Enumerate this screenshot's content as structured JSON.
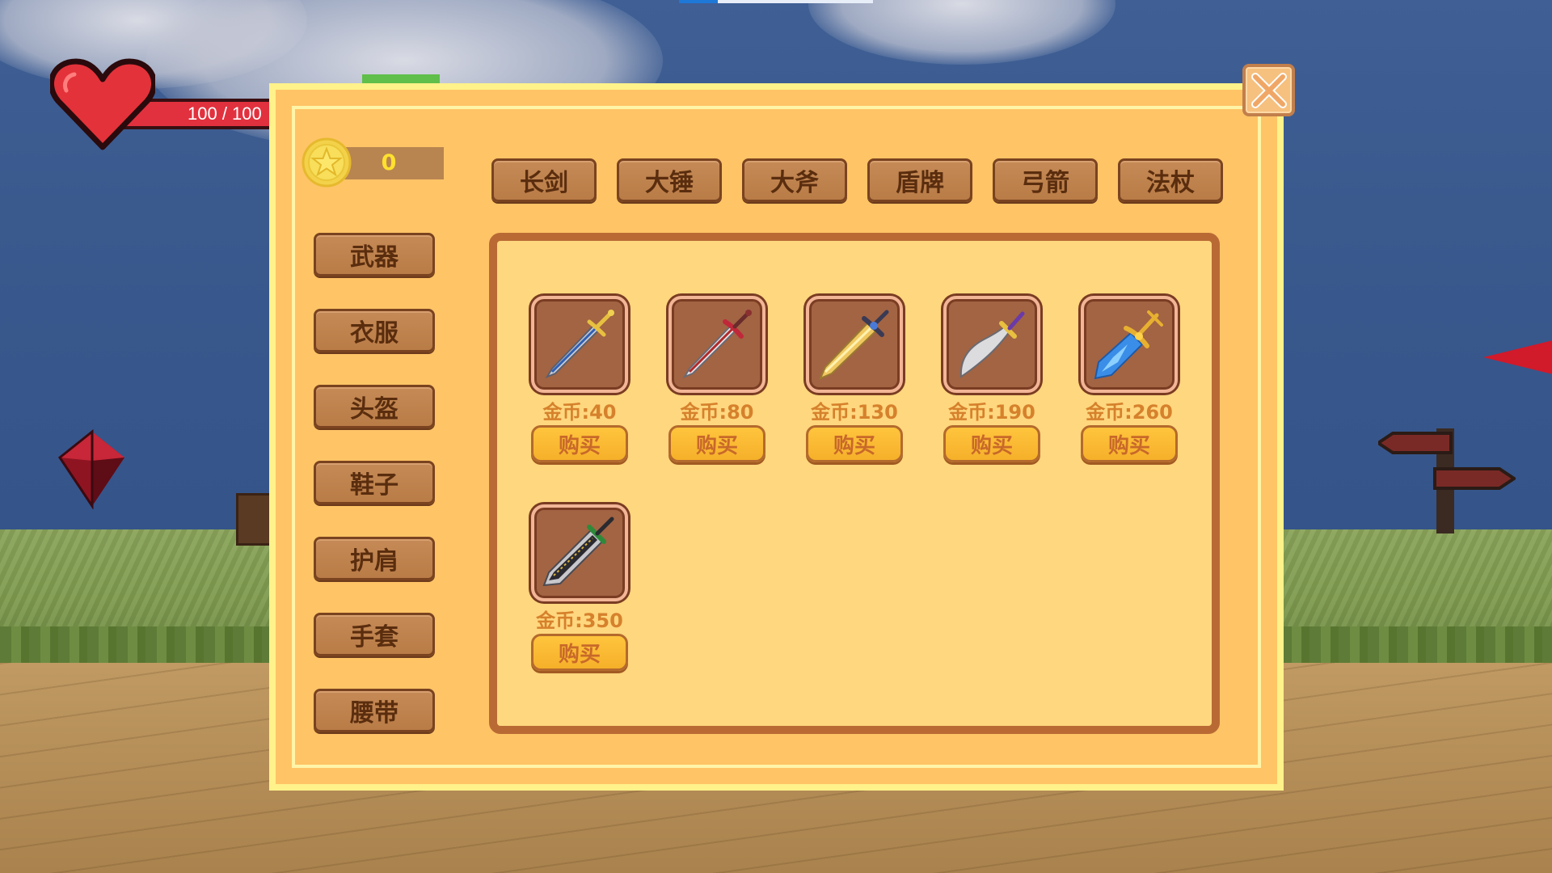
{
  "hud": {
    "hp_text": "100  / 100",
    "hp_current": 100,
    "hp_max": 100
  },
  "shop": {
    "coins": "0",
    "tabs": [
      "长剑",
      "大锤",
      "大斧",
      "盾牌",
      "弓箭",
      "法杖"
    ],
    "categories": [
      "武器",
      "衣服",
      "头盔",
      "鞋子",
      "护肩",
      "手套",
      "腰带"
    ],
    "items": [
      {
        "icon": "longsword-blue-icon",
        "price": "金币:40",
        "buy": "购买"
      },
      {
        "icon": "longsword-red-icon",
        "price": "金币:80",
        "buy": "购买"
      },
      {
        "icon": "longsword-gold-icon",
        "price": "金币:130",
        "buy": "购买"
      },
      {
        "icon": "scimitar-icon",
        "price": "金币:190",
        "buy": "购买"
      },
      {
        "icon": "crystal-sword-icon",
        "price": "金币:260",
        "buy": "购买"
      },
      {
        "icon": "runed-greatsword-icon",
        "price": "金币:350",
        "buy": "购买"
      }
    ]
  },
  "colors": {
    "panel": "#ffc466",
    "panel_border": "#fff28a",
    "wood_button": "#b97c47",
    "buy_button": "#f6b02a",
    "price_text": "#d6812c",
    "coin_text": "#ffe12e",
    "hp_bar": "#e2313e"
  }
}
